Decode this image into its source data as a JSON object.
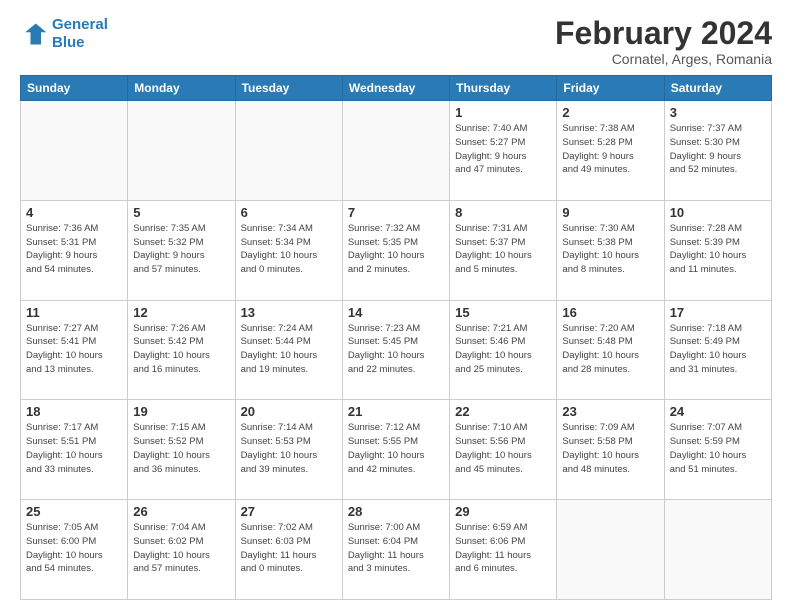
{
  "logo": {
    "line1": "General",
    "line2": "Blue"
  },
  "title": "February 2024",
  "subtitle": "Cornatel, Arges, Romania",
  "weekdays": [
    "Sunday",
    "Monday",
    "Tuesday",
    "Wednesday",
    "Thursday",
    "Friday",
    "Saturday"
  ],
  "weeks": [
    [
      {
        "day": "",
        "info": ""
      },
      {
        "day": "",
        "info": ""
      },
      {
        "day": "",
        "info": ""
      },
      {
        "day": "",
        "info": ""
      },
      {
        "day": "1",
        "info": "Sunrise: 7:40 AM\nSunset: 5:27 PM\nDaylight: 9 hours\nand 47 minutes."
      },
      {
        "day": "2",
        "info": "Sunrise: 7:38 AM\nSunset: 5:28 PM\nDaylight: 9 hours\nand 49 minutes."
      },
      {
        "day": "3",
        "info": "Sunrise: 7:37 AM\nSunset: 5:30 PM\nDaylight: 9 hours\nand 52 minutes."
      }
    ],
    [
      {
        "day": "4",
        "info": "Sunrise: 7:36 AM\nSunset: 5:31 PM\nDaylight: 9 hours\nand 54 minutes."
      },
      {
        "day": "5",
        "info": "Sunrise: 7:35 AM\nSunset: 5:32 PM\nDaylight: 9 hours\nand 57 minutes."
      },
      {
        "day": "6",
        "info": "Sunrise: 7:34 AM\nSunset: 5:34 PM\nDaylight: 10 hours\nand 0 minutes."
      },
      {
        "day": "7",
        "info": "Sunrise: 7:32 AM\nSunset: 5:35 PM\nDaylight: 10 hours\nand 2 minutes."
      },
      {
        "day": "8",
        "info": "Sunrise: 7:31 AM\nSunset: 5:37 PM\nDaylight: 10 hours\nand 5 minutes."
      },
      {
        "day": "9",
        "info": "Sunrise: 7:30 AM\nSunset: 5:38 PM\nDaylight: 10 hours\nand 8 minutes."
      },
      {
        "day": "10",
        "info": "Sunrise: 7:28 AM\nSunset: 5:39 PM\nDaylight: 10 hours\nand 11 minutes."
      }
    ],
    [
      {
        "day": "11",
        "info": "Sunrise: 7:27 AM\nSunset: 5:41 PM\nDaylight: 10 hours\nand 13 minutes."
      },
      {
        "day": "12",
        "info": "Sunrise: 7:26 AM\nSunset: 5:42 PM\nDaylight: 10 hours\nand 16 minutes."
      },
      {
        "day": "13",
        "info": "Sunrise: 7:24 AM\nSunset: 5:44 PM\nDaylight: 10 hours\nand 19 minutes."
      },
      {
        "day": "14",
        "info": "Sunrise: 7:23 AM\nSunset: 5:45 PM\nDaylight: 10 hours\nand 22 minutes."
      },
      {
        "day": "15",
        "info": "Sunrise: 7:21 AM\nSunset: 5:46 PM\nDaylight: 10 hours\nand 25 minutes."
      },
      {
        "day": "16",
        "info": "Sunrise: 7:20 AM\nSunset: 5:48 PM\nDaylight: 10 hours\nand 28 minutes."
      },
      {
        "day": "17",
        "info": "Sunrise: 7:18 AM\nSunset: 5:49 PM\nDaylight: 10 hours\nand 31 minutes."
      }
    ],
    [
      {
        "day": "18",
        "info": "Sunrise: 7:17 AM\nSunset: 5:51 PM\nDaylight: 10 hours\nand 33 minutes."
      },
      {
        "day": "19",
        "info": "Sunrise: 7:15 AM\nSunset: 5:52 PM\nDaylight: 10 hours\nand 36 minutes."
      },
      {
        "day": "20",
        "info": "Sunrise: 7:14 AM\nSunset: 5:53 PM\nDaylight: 10 hours\nand 39 minutes."
      },
      {
        "day": "21",
        "info": "Sunrise: 7:12 AM\nSunset: 5:55 PM\nDaylight: 10 hours\nand 42 minutes."
      },
      {
        "day": "22",
        "info": "Sunrise: 7:10 AM\nSunset: 5:56 PM\nDaylight: 10 hours\nand 45 minutes."
      },
      {
        "day": "23",
        "info": "Sunrise: 7:09 AM\nSunset: 5:58 PM\nDaylight: 10 hours\nand 48 minutes."
      },
      {
        "day": "24",
        "info": "Sunrise: 7:07 AM\nSunset: 5:59 PM\nDaylight: 10 hours\nand 51 minutes."
      }
    ],
    [
      {
        "day": "25",
        "info": "Sunrise: 7:05 AM\nSunset: 6:00 PM\nDaylight: 10 hours\nand 54 minutes."
      },
      {
        "day": "26",
        "info": "Sunrise: 7:04 AM\nSunset: 6:02 PM\nDaylight: 10 hours\nand 57 minutes."
      },
      {
        "day": "27",
        "info": "Sunrise: 7:02 AM\nSunset: 6:03 PM\nDaylight: 11 hours\nand 0 minutes."
      },
      {
        "day": "28",
        "info": "Sunrise: 7:00 AM\nSunset: 6:04 PM\nDaylight: 11 hours\nand 3 minutes."
      },
      {
        "day": "29",
        "info": "Sunrise: 6:59 AM\nSunset: 6:06 PM\nDaylight: 11 hours\nand 6 minutes."
      },
      {
        "day": "",
        "info": ""
      },
      {
        "day": "",
        "info": ""
      }
    ]
  ]
}
